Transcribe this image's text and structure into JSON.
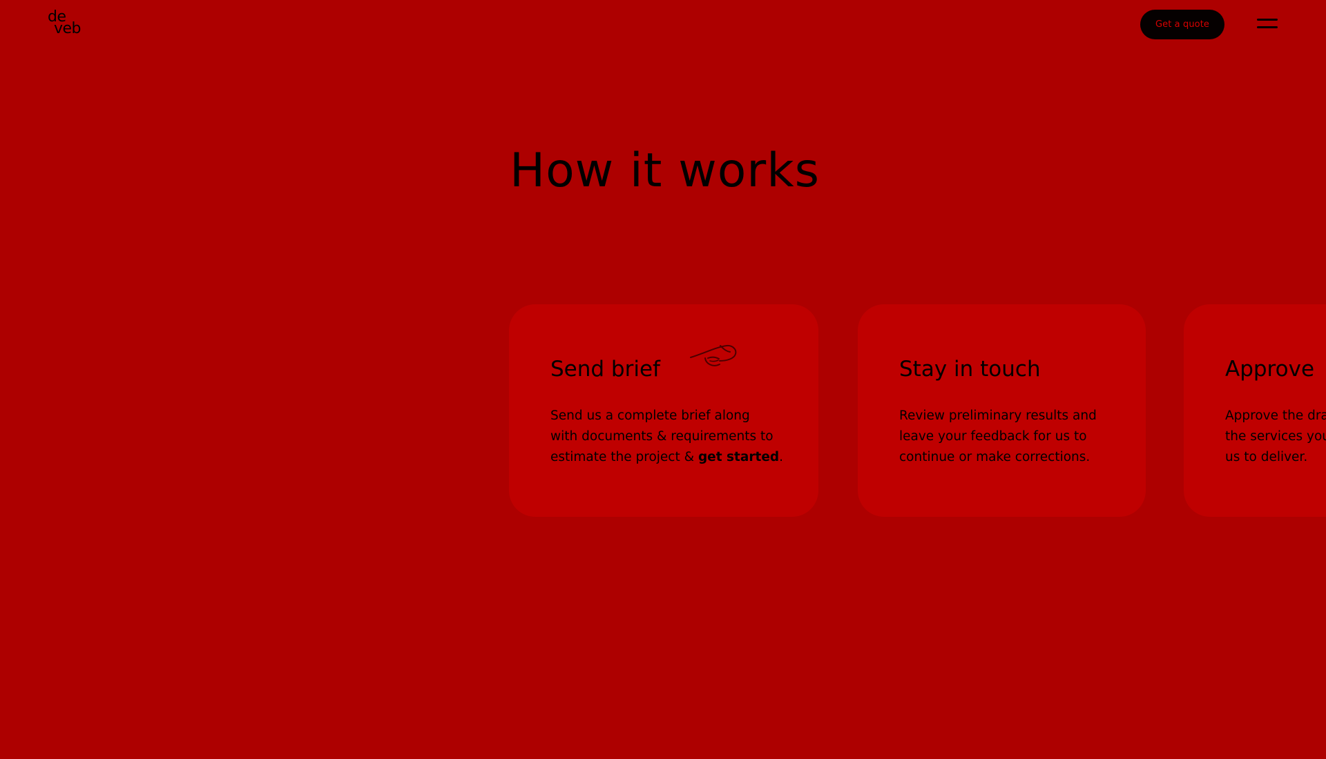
{
  "header": {
    "logo": {
      "line1": "de",
      "line2": "veb"
    },
    "quote_button": "Get a quote",
    "menu_icon": "hamburger-menu-icon"
  },
  "main": {
    "title": "How it works",
    "cards": [
      {
        "title": "Send brief",
        "icon": "paper-plane-icon",
        "lines": [
          "Send us a complete brief along",
          "with documents & requirements to",
          "estimate the project & "
        ],
        "emphasis": "get started",
        "after_emphasis": "."
      },
      {
        "title": "Stay in touch",
        "lines": [
          "Review preliminary results and",
          "leave your feedback for us to",
          "continue or make corrections."
        ]
      },
      {
        "title": "Approve",
        "lines": [
          "Approve the dra",
          "the services you",
          "us to deliver."
        ]
      }
    ]
  },
  "colors": {
    "background": "#ad0000",
    "card": "#bf0000",
    "button": "#050000",
    "button_text": "#d70000",
    "text": "#000000"
  }
}
